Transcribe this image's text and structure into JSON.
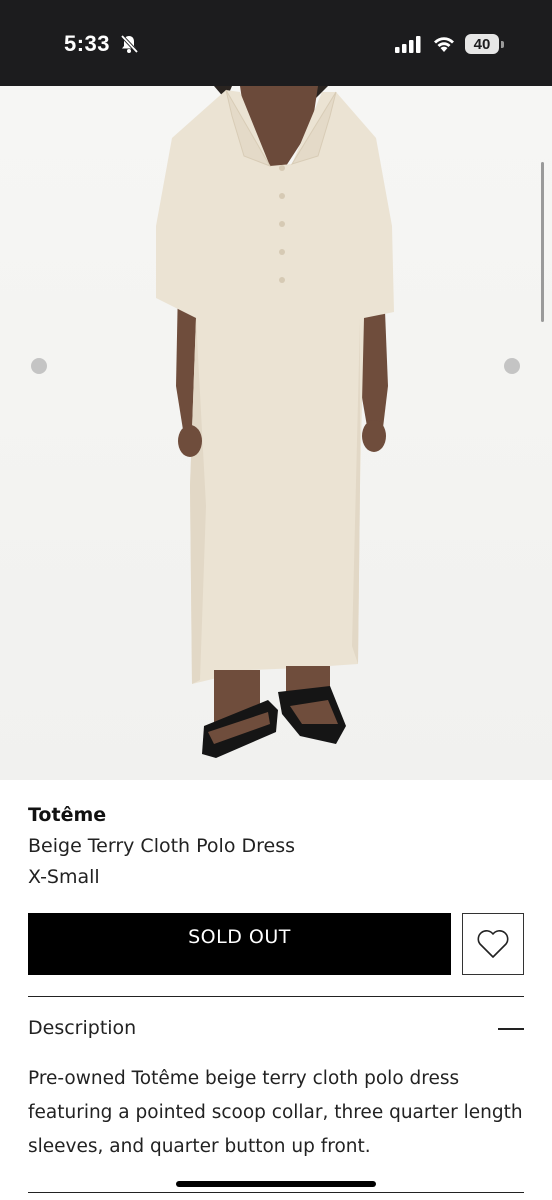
{
  "status_bar": {
    "time": "5:33",
    "battery": "40",
    "icons": [
      "bell-off-icon",
      "cellular-signal-icon",
      "wifi-icon",
      "battery-icon"
    ]
  },
  "product": {
    "brand": "Totême",
    "name": "Beige Terry Cloth Polo Dress",
    "size": "X-Small",
    "sold_out_label": "SOLD OUT",
    "wishlist_icon": "heart-icon"
  },
  "description": {
    "title": "Description",
    "text": "Pre-owned Totême beige terry cloth polo dress featuring a pointed scoop collar, three quarter length sleeves, and quarter button up front.",
    "toggle_icon": "minus-icon"
  },
  "colors": {
    "status_bar_bg": "#1c1c1e",
    "button_bg": "#000000",
    "dress": "#ebe3d3"
  }
}
